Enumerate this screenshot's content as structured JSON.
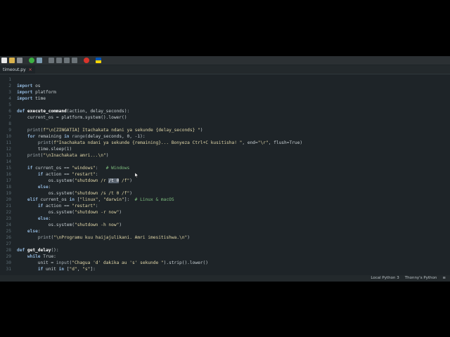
{
  "tab": {
    "label": "timeout.py",
    "close": "×"
  },
  "status": {
    "interpreter": "Local Python 3",
    "backend": "Thonny's Python",
    "menu": "≡"
  },
  "code": {
    "lines": [
      {
        "n": "1",
        "segs": []
      },
      {
        "n": "2",
        "segs": [
          {
            "t": "import",
            "c": "kw"
          },
          {
            "t": " os",
            "c": "nm"
          }
        ]
      },
      {
        "n": "3",
        "segs": [
          {
            "t": "import",
            "c": "kw"
          },
          {
            "t": " platform",
            "c": "nm"
          }
        ]
      },
      {
        "n": "4",
        "segs": [
          {
            "t": "import",
            "c": "kw"
          },
          {
            "t": " time",
            "c": "nm"
          }
        ]
      },
      {
        "n": "5",
        "segs": []
      },
      {
        "n": "6",
        "segs": [
          {
            "t": "def ",
            "c": "kw"
          },
          {
            "t": "execute_command",
            "c": "fn"
          },
          {
            "t": "(action, delay_seconds):",
            "c": "nm"
          }
        ]
      },
      {
        "n": "7",
        "segs": [
          {
            "t": "    current_os = platform.system().lower()",
            "c": "nm"
          }
        ]
      },
      {
        "n": "8",
        "segs": []
      },
      {
        "n": "9",
        "segs": [
          {
            "t": "    ",
            "c": "nm"
          },
          {
            "t": "print",
            "c": "bi"
          },
          {
            "t": "(",
            "c": "nm"
          },
          {
            "t": "f\"\\n[ZINGATIA] Itachakata ndani ya sekunde {delay_seconds} \"",
            "c": "st"
          },
          {
            "t": ")",
            "c": "nm"
          }
        ]
      },
      {
        "n": "10",
        "segs": [
          {
            "t": "    ",
            "c": "nm"
          },
          {
            "t": "for",
            "c": "kw"
          },
          {
            "t": " remaining ",
            "c": "nm"
          },
          {
            "t": "in",
            "c": "kw"
          },
          {
            "t": " ",
            "c": "nm"
          },
          {
            "t": "range",
            "c": "bi"
          },
          {
            "t": "(delay_seconds, 0, -1):",
            "c": "nm"
          }
        ]
      },
      {
        "n": "11",
        "segs": [
          {
            "t": "        ",
            "c": "nm"
          },
          {
            "t": "print",
            "c": "bi"
          },
          {
            "t": "(",
            "c": "nm"
          },
          {
            "t": "f\"Inachakata ndani ya sekunde {remaining}... Bonyeza Ctrl+C kusitisha! \"",
            "c": "st"
          },
          {
            "t": ", end=",
            "c": "nm"
          },
          {
            "t": "\"\\r\"",
            "c": "st"
          },
          {
            "t": ", flush=True)",
            "c": "nm"
          }
        ]
      },
      {
        "n": "12",
        "segs": [
          {
            "t": "        time.sleep(1)",
            "c": "nm"
          }
        ]
      },
      {
        "n": "13",
        "segs": [
          {
            "t": "    ",
            "c": "nm"
          },
          {
            "t": "print",
            "c": "bi"
          },
          {
            "t": "(",
            "c": "nm"
          },
          {
            "t": "\"\\nInachakata amri...\\n\"",
            "c": "st"
          },
          {
            "t": ")",
            "c": "nm"
          }
        ]
      },
      {
        "n": "14",
        "segs": []
      },
      {
        "n": "15",
        "segs": [
          {
            "t": "    ",
            "c": "nm"
          },
          {
            "t": "if",
            "c": "kw"
          },
          {
            "t": " current_os == ",
            "c": "nm"
          },
          {
            "t": "\"windows\"",
            "c": "st"
          },
          {
            "t": ":   ",
            "c": "nm"
          },
          {
            "t": "# Windows",
            "c": "cm"
          }
        ]
      },
      {
        "n": "16",
        "segs": [
          {
            "t": "        ",
            "c": "nm"
          },
          {
            "t": "if",
            "c": "kw"
          },
          {
            "t": " action == ",
            "c": "nm"
          },
          {
            "t": "\"restart\"",
            "c": "st"
          },
          {
            "t": ":",
            "c": "nm"
          }
        ]
      },
      {
        "n": "17",
        "segs": [
          {
            "t": "            os.system(",
            "c": "nm"
          },
          {
            "t": "\"shutdown /r ",
            "c": "st"
          },
          {
            "t": "/t 0",
            "c": "sel"
          },
          {
            "t": " /f\"",
            "c": "st"
          },
          {
            "t": ")",
            "c": "nm"
          }
        ]
      },
      {
        "n": "18",
        "segs": [
          {
            "t": "        ",
            "c": "nm"
          },
          {
            "t": "else",
            "c": "kw"
          },
          {
            "t": ":",
            "c": "nm"
          }
        ]
      },
      {
        "n": "19",
        "segs": [
          {
            "t": "            os.system(",
            "c": "nm"
          },
          {
            "t": "\"shutdown /s /t 0 /f\"",
            "c": "st"
          },
          {
            "t": ")",
            "c": "nm"
          }
        ]
      },
      {
        "n": "20",
        "segs": [
          {
            "t": "    ",
            "c": "nm"
          },
          {
            "t": "elif",
            "c": "kw"
          },
          {
            "t": " current_os ",
            "c": "nm"
          },
          {
            "t": "in",
            "c": "kw"
          },
          {
            "t": " [",
            "c": "nm"
          },
          {
            "t": "\"linux\"",
            "c": "st"
          },
          {
            "t": ", ",
            "c": "nm"
          },
          {
            "t": "\"darwin\"",
            "c": "st"
          },
          {
            "t": "]:  ",
            "c": "nm"
          },
          {
            "t": "# Linux & macOS",
            "c": "cm"
          }
        ]
      },
      {
        "n": "21",
        "segs": [
          {
            "t": "        ",
            "c": "nm"
          },
          {
            "t": "if",
            "c": "kw"
          },
          {
            "t": " action == ",
            "c": "nm"
          },
          {
            "t": "\"restart\"",
            "c": "st"
          },
          {
            "t": ":",
            "c": "nm"
          }
        ]
      },
      {
        "n": "22",
        "segs": [
          {
            "t": "            os.system(",
            "c": "nm"
          },
          {
            "t": "\"shutdown -r now\"",
            "c": "st"
          },
          {
            "t": ")",
            "c": "nm"
          }
        ]
      },
      {
        "n": "23",
        "segs": [
          {
            "t": "        ",
            "c": "nm"
          },
          {
            "t": "else",
            "c": "kw"
          },
          {
            "t": ":",
            "c": "nm"
          }
        ]
      },
      {
        "n": "24",
        "segs": [
          {
            "t": "            os.system(",
            "c": "nm"
          },
          {
            "t": "\"shutdown -h now\"",
            "c": "st"
          },
          {
            "t": ")",
            "c": "nm"
          }
        ]
      },
      {
        "n": "25",
        "segs": [
          {
            "t": "    ",
            "c": "nm"
          },
          {
            "t": "else",
            "c": "kw"
          },
          {
            "t": ":",
            "c": "nm"
          }
        ]
      },
      {
        "n": "26",
        "segs": [
          {
            "t": "        ",
            "c": "nm"
          },
          {
            "t": "print",
            "c": "bi"
          },
          {
            "t": "(",
            "c": "nm"
          },
          {
            "t": "\"\\nProgramu kuu haijajulikani. Amri imesitishwa.\\n\"",
            "c": "st"
          },
          {
            "t": ")",
            "c": "nm"
          }
        ]
      },
      {
        "n": "27",
        "segs": []
      },
      {
        "n": "28",
        "segs": [
          {
            "t": "def ",
            "c": "kw"
          },
          {
            "t": "get_delay",
            "c": "fn"
          },
          {
            "t": "():",
            "c": "nm"
          }
        ]
      },
      {
        "n": "29",
        "segs": [
          {
            "t": "    ",
            "c": "nm"
          },
          {
            "t": "while",
            "c": "kw"
          },
          {
            "t": " True:",
            "c": "nm"
          }
        ]
      },
      {
        "n": "30",
        "segs": [
          {
            "t": "        unit = ",
            "c": "nm"
          },
          {
            "t": "input",
            "c": "bi"
          },
          {
            "t": "(",
            "c": "nm"
          },
          {
            "t": "\"Chagua 'd' dakika au 's' sekunde \"",
            "c": "st"
          },
          {
            "t": ").strip().lower()",
            "c": "nm"
          }
        ]
      },
      {
        "n": "31",
        "segs": [
          {
            "t": "        ",
            "c": "nm"
          },
          {
            "t": "if",
            "c": "kw"
          },
          {
            "t": " unit ",
            "c": "nm"
          },
          {
            "t": "in",
            "c": "kw"
          },
          {
            "t": " [",
            "c": "nm"
          },
          {
            "t": "\"d\"",
            "c": "st"
          },
          {
            "t": ", ",
            "c": "nm"
          },
          {
            "t": "\"s\"",
            "c": "st"
          },
          {
            "t": "]:",
            "c": "nm"
          }
        ]
      }
    ]
  },
  "toolbar": {
    "buttons": [
      {
        "name": "new-file-icon",
        "color": "#e8e8e8"
      },
      {
        "name": "open-file-icon",
        "color": "#d9b24c"
      },
      {
        "name": "save-icon",
        "color": "#8a8f94"
      },
      {
        "name": "sep",
        "color": ""
      },
      {
        "name": "run-icon",
        "color": "#3cb043"
      },
      {
        "name": "debug-icon",
        "color": "#7a9ab0"
      },
      {
        "name": "sep",
        "color": ""
      },
      {
        "name": "step-over-icon",
        "color": "#6b7378"
      },
      {
        "name": "step-into-icon",
        "color": "#6b7378"
      },
      {
        "name": "step-out-icon",
        "color": "#6b7378"
      },
      {
        "name": "resume-icon",
        "color": "#6b7378"
      },
      {
        "name": "sep",
        "color": ""
      },
      {
        "name": "stop-icon",
        "color": "#d9342b"
      },
      {
        "name": "sep",
        "color": ""
      },
      {
        "name": "ukraine-flag-icon",
        "color": "#ffd500"
      }
    ]
  }
}
